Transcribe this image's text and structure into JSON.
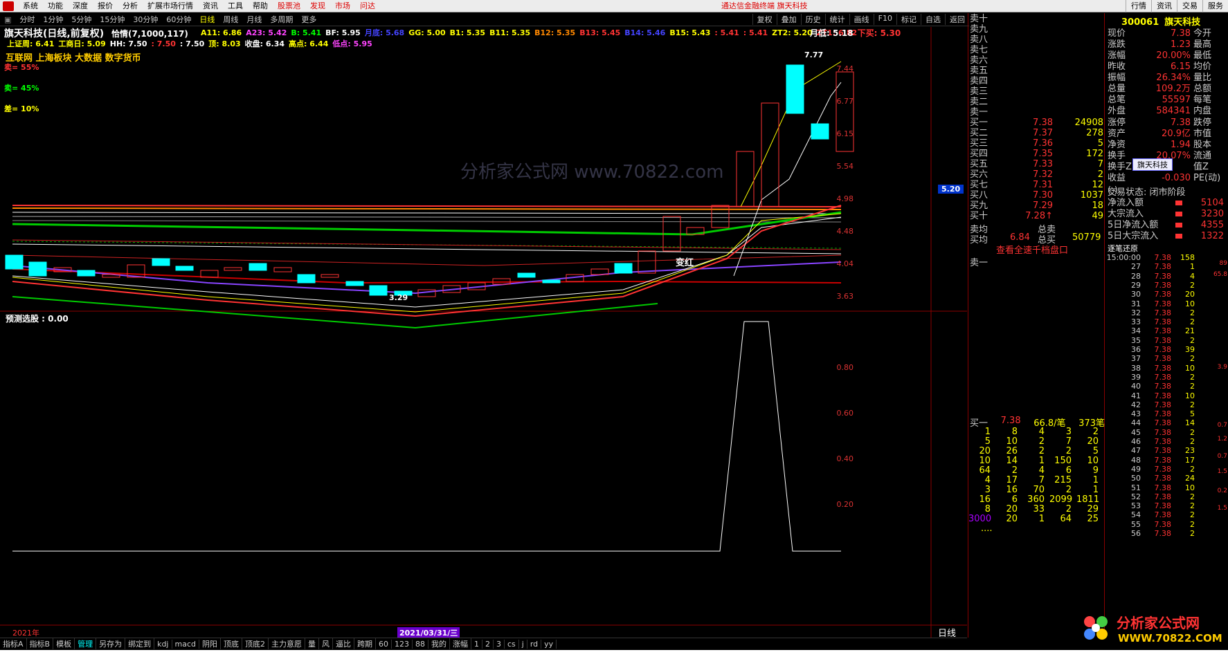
{
  "menubar": {
    "items": [
      "系统",
      "功能",
      "深度",
      "报价",
      "分析",
      "扩展市场行情",
      "资讯",
      "工具",
      "帮助"
    ],
    "red_items": [
      "股票池",
      "发现",
      "市场",
      "问达"
    ],
    "center_text": "通达信金融终端  旗天科技",
    "right_items": [
      "行情",
      "资讯",
      "交易",
      "服务"
    ]
  },
  "toolbar": {
    "periods": [
      "分时",
      "1分钟",
      "5分钟",
      "15分钟",
      "30分钟",
      "60分钟",
      "日线",
      "周线",
      "月线",
      "多周期",
      "更多"
    ],
    "active": "日线",
    "tools": [
      "复权",
      "叠加",
      "历史",
      "统计",
      "画线",
      "F10",
      "标记",
      "自选",
      "返回"
    ]
  },
  "chart": {
    "title": "旗天科技(日线,前复权)",
    "indicator": "恰情(7,1000,117)",
    "line1": [
      {
        "label": "A11: 6.86",
        "color": "#ffff00"
      },
      {
        "label": "A23: 5.42",
        "color": "#ff44ff"
      },
      {
        "label": "B: 5.41",
        "color": "#00ff00"
      },
      {
        "label": "BF: 5.95",
        "color": "#ffffff"
      },
      {
        "label": "月底: 5.68",
        "color": "#4444ff"
      },
      {
        "label": "GG: 5.00",
        "color": "#ffff00"
      },
      {
        "label": "B1: 5.35",
        "color": "#ffff00"
      },
      {
        "label": "B11: 5.35",
        "color": "#ffff00"
      },
      {
        "label": "B12: 5.35",
        "color": "#ff8800"
      },
      {
        "label": "B13: 5.45",
        "color": "#ff3333"
      },
      {
        "label": "B14: 5.46",
        "color": "#4444ff"
      },
      {
        "label": "B15: 5.43",
        "color": "#ffff00"
      },
      {
        "label": ": 5.41",
        "color": "#ff3333"
      },
      {
        "label": ": 5.41",
        "color": "#ff3333"
      },
      {
        "label": "ZT2: 5.20",
        "color": "#ffff00"
      },
      {
        "label": "ZT1: 6.82",
        "color": "#ff3333"
      }
    ],
    "line1_right": [
      {
        "label": "月低: 5.18",
        "color": "#ffffff"
      },
      {
        "label": "下买: 5.30",
        "color": "#ff3333"
      }
    ],
    "line2": [
      {
        "label": "上证周: 6.41",
        "color": "#ffff00"
      },
      {
        "label": "工商日: 5.09",
        "color": "#ffff00"
      },
      {
        "label": "HH: 7.50",
        "color": "#ffffff"
      },
      {
        "label": ": 7.50",
        "color": "#ff3333"
      },
      {
        "label": ": 7.50",
        "color": "#ffffff"
      },
      {
        "label": "顶: 8.03",
        "color": "#ffff00"
      },
      {
        "label": "收盘: 6.34",
        "color": "#ffffff"
      },
      {
        "label": "高点: 6.44",
        "color": "#ffff00"
      },
      {
        "label": "低点: 5.95",
        "color": "#ff44ff"
      }
    ],
    "concepts": "互联网 上海板块 大数据 数字货币",
    "sell_pct": "卖= 55%",
    "sell2_pct": "卖= 45%",
    "diff_pct": "差= 10%",
    "price_axis": [
      "7.44",
      "6.77",
      "6.15",
      "5.54",
      "4.98",
      "4.48",
      "4.04",
      "3.63"
    ],
    "current_price_tag": "5.20",
    "high_label": "7.77",
    "low_label": "3.29",
    "bianhong_label": "变红",
    "watermark": "分析家公式网 www.70822.com"
  },
  "subchart": {
    "title": "预测选股 : 0.00",
    "axis": [
      "0.80",
      "0.60",
      "0.40",
      "0.20"
    ],
    "year_label": "2021年",
    "date_label": "2021/03/31/三",
    "period_label": "日线"
  },
  "bottombar": {
    "items": [
      "指标A",
      "指标B",
      "模板",
      "管理",
      "另存为",
      "绑定到",
      "kdj",
      "macd",
      "阴阳",
      "顶底",
      "顶底2",
      "主力意愿",
      "量",
      "风",
      "逼比",
      "跨期",
      "60",
      "123",
      "88",
      "我的",
      "涨幅",
      "1",
      "2",
      "3",
      "cs",
      "j",
      "rd",
      "yy"
    ],
    "active": "管理"
  },
  "orderbook": {
    "sells": [
      "卖十",
      "卖九",
      "卖八",
      "卖七",
      "卖六",
      "卖五",
      "卖四",
      "卖三",
      "卖二",
      "卖一"
    ],
    "buys": [
      {
        "name": "买一",
        "price": "7.38",
        "vol": "24908"
      },
      {
        "name": "买二",
        "price": "7.37",
        "vol": "278"
      },
      {
        "name": "买三",
        "price": "7.36",
        "vol": "5"
      },
      {
        "name": "买四",
        "price": "7.35",
        "vol": "172"
      },
      {
        "name": "买五",
        "price": "7.33",
        "vol": "7"
      },
      {
        "name": "买六",
        "price": "7.32",
        "vol": "2"
      },
      {
        "name": "买七",
        "price": "7.31",
        "vol": "12"
      },
      {
        "name": "买八",
        "price": "7.30",
        "vol": "1037"
      },
      {
        "name": "买九",
        "price": "7.29",
        "vol": "18"
      },
      {
        "name": "买十",
        "price": "7.28↑",
        "vol": "49"
      }
    ],
    "sell_avg": "卖均",
    "total_sell": "总卖",
    "buy_avg_label": "买均",
    "buy_avg": "6.84",
    "total_buy_label": "总买",
    "total_buy": "50779",
    "view_link": "查看全速千档盘口",
    "sell1_label": "卖一",
    "buy1_summary": {
      "label": "买一",
      "price": "7.38",
      "per": "66.8/笔",
      "count": "373笔"
    },
    "queue": [
      [
        "1",
        "8",
        "4",
        "3",
        "2"
      ],
      [
        "5",
        "10",
        "2",
        "7",
        "20"
      ],
      [
        "20",
        "26",
        "2",
        "2",
        "5"
      ],
      [
        "10",
        "14",
        "1",
        "150",
        "10"
      ],
      [
        "64",
        "2",
        "4",
        "6",
        "9"
      ],
      [
        "4",
        "17",
        "7",
        "215",
        "1"
      ],
      [
        "3",
        "16",
        "70",
        "2",
        "1"
      ],
      [
        "16",
        "6",
        "360",
        "2099",
        "1811"
      ],
      [
        "8",
        "20",
        "33",
        "2",
        "29"
      ],
      [
        "3000",
        "20",
        "1",
        "64",
        "25"
      ]
    ],
    "queue_more": "...."
  },
  "stock": {
    "code": "300061",
    "name": "旗天科技",
    "rows": [
      {
        "k": "现价",
        "v": "7.38",
        "k2": "今开"
      },
      {
        "k": "涨跌",
        "v": "1.23",
        "k2": "最高"
      },
      {
        "k": "涨幅",
        "v": "20.00%",
        "k2": "最低"
      },
      {
        "k": "昨收",
        "v": "6.15",
        "k2": "均价"
      },
      {
        "k": "振幅",
        "v": "26.34%",
        "k2": "量比"
      },
      {
        "k": "总量",
        "v": "109.2万",
        "k2": "总额"
      },
      {
        "k": "总笔",
        "v": "55597",
        "k2": "每笔"
      },
      {
        "k": "外盘",
        "v": "584341",
        "k2": "内盘"
      }
    ],
    "rows2": [
      {
        "k": "涨停",
        "v": "7.38",
        "k2": "跌停"
      },
      {
        "k": "资产",
        "v": "20.9亿",
        "k2": "市值"
      },
      {
        "k": "净资",
        "v": "1.94",
        "k2": "股本"
      },
      {
        "k": "换手",
        "v": "20.07%",
        "k2": "流通"
      },
      {
        "k": "换手Z",
        "v": "",
        "k2": "值Z"
      },
      {
        "k": "收益(-)",
        "v": "-0.030",
        "k2": "PE(动)"
      }
    ],
    "status": "交易状态: 闭市阶段",
    "flows": [
      {
        "k": "净流入额",
        "v": "5104"
      },
      {
        "k": "大宗流入",
        "v": "3230"
      },
      {
        "k": "5日净流入额",
        "v": "4355"
      },
      {
        "k": "5日大宗流入",
        "v": "1322"
      }
    ],
    "cloud_tag": "旗天科技",
    "ticks_title": "逐笔还原",
    "tick_first_time": "15:00:00",
    "tick_price": "7.38",
    "tick_times": [
      "15:00:00",
      "27",
      "28",
      "29",
      "30",
      "31",
      "32",
      "33",
      "34",
      "35",
      "36",
      "37",
      "38",
      "39",
      "40",
      "41",
      "42",
      "43",
      "44",
      "45",
      "46",
      "47",
      "48",
      "49",
      "50",
      "51",
      "52",
      "53",
      "54",
      "55",
      "56"
    ],
    "tick_vols": [
      "158",
      "1",
      "4",
      "2",
      "20",
      "10",
      "2",
      "2",
      "21",
      "2",
      "39",
      "2",
      "10",
      "2",
      "2",
      "10",
      "2",
      "5",
      "14",
      "2",
      "2",
      "23",
      "17",
      "2",
      "24",
      "10",
      "2",
      "2",
      "2",
      "2",
      "2"
    ],
    "side_values": [
      "89",
      "65.8",
      "3.9",
      "0.7",
      "1.2",
      "0.7",
      "1.5",
      "0.2",
      "1.5"
    ]
  },
  "brand": {
    "name": "分析家公式网",
    "url": "WWW.70822.COM"
  }
}
